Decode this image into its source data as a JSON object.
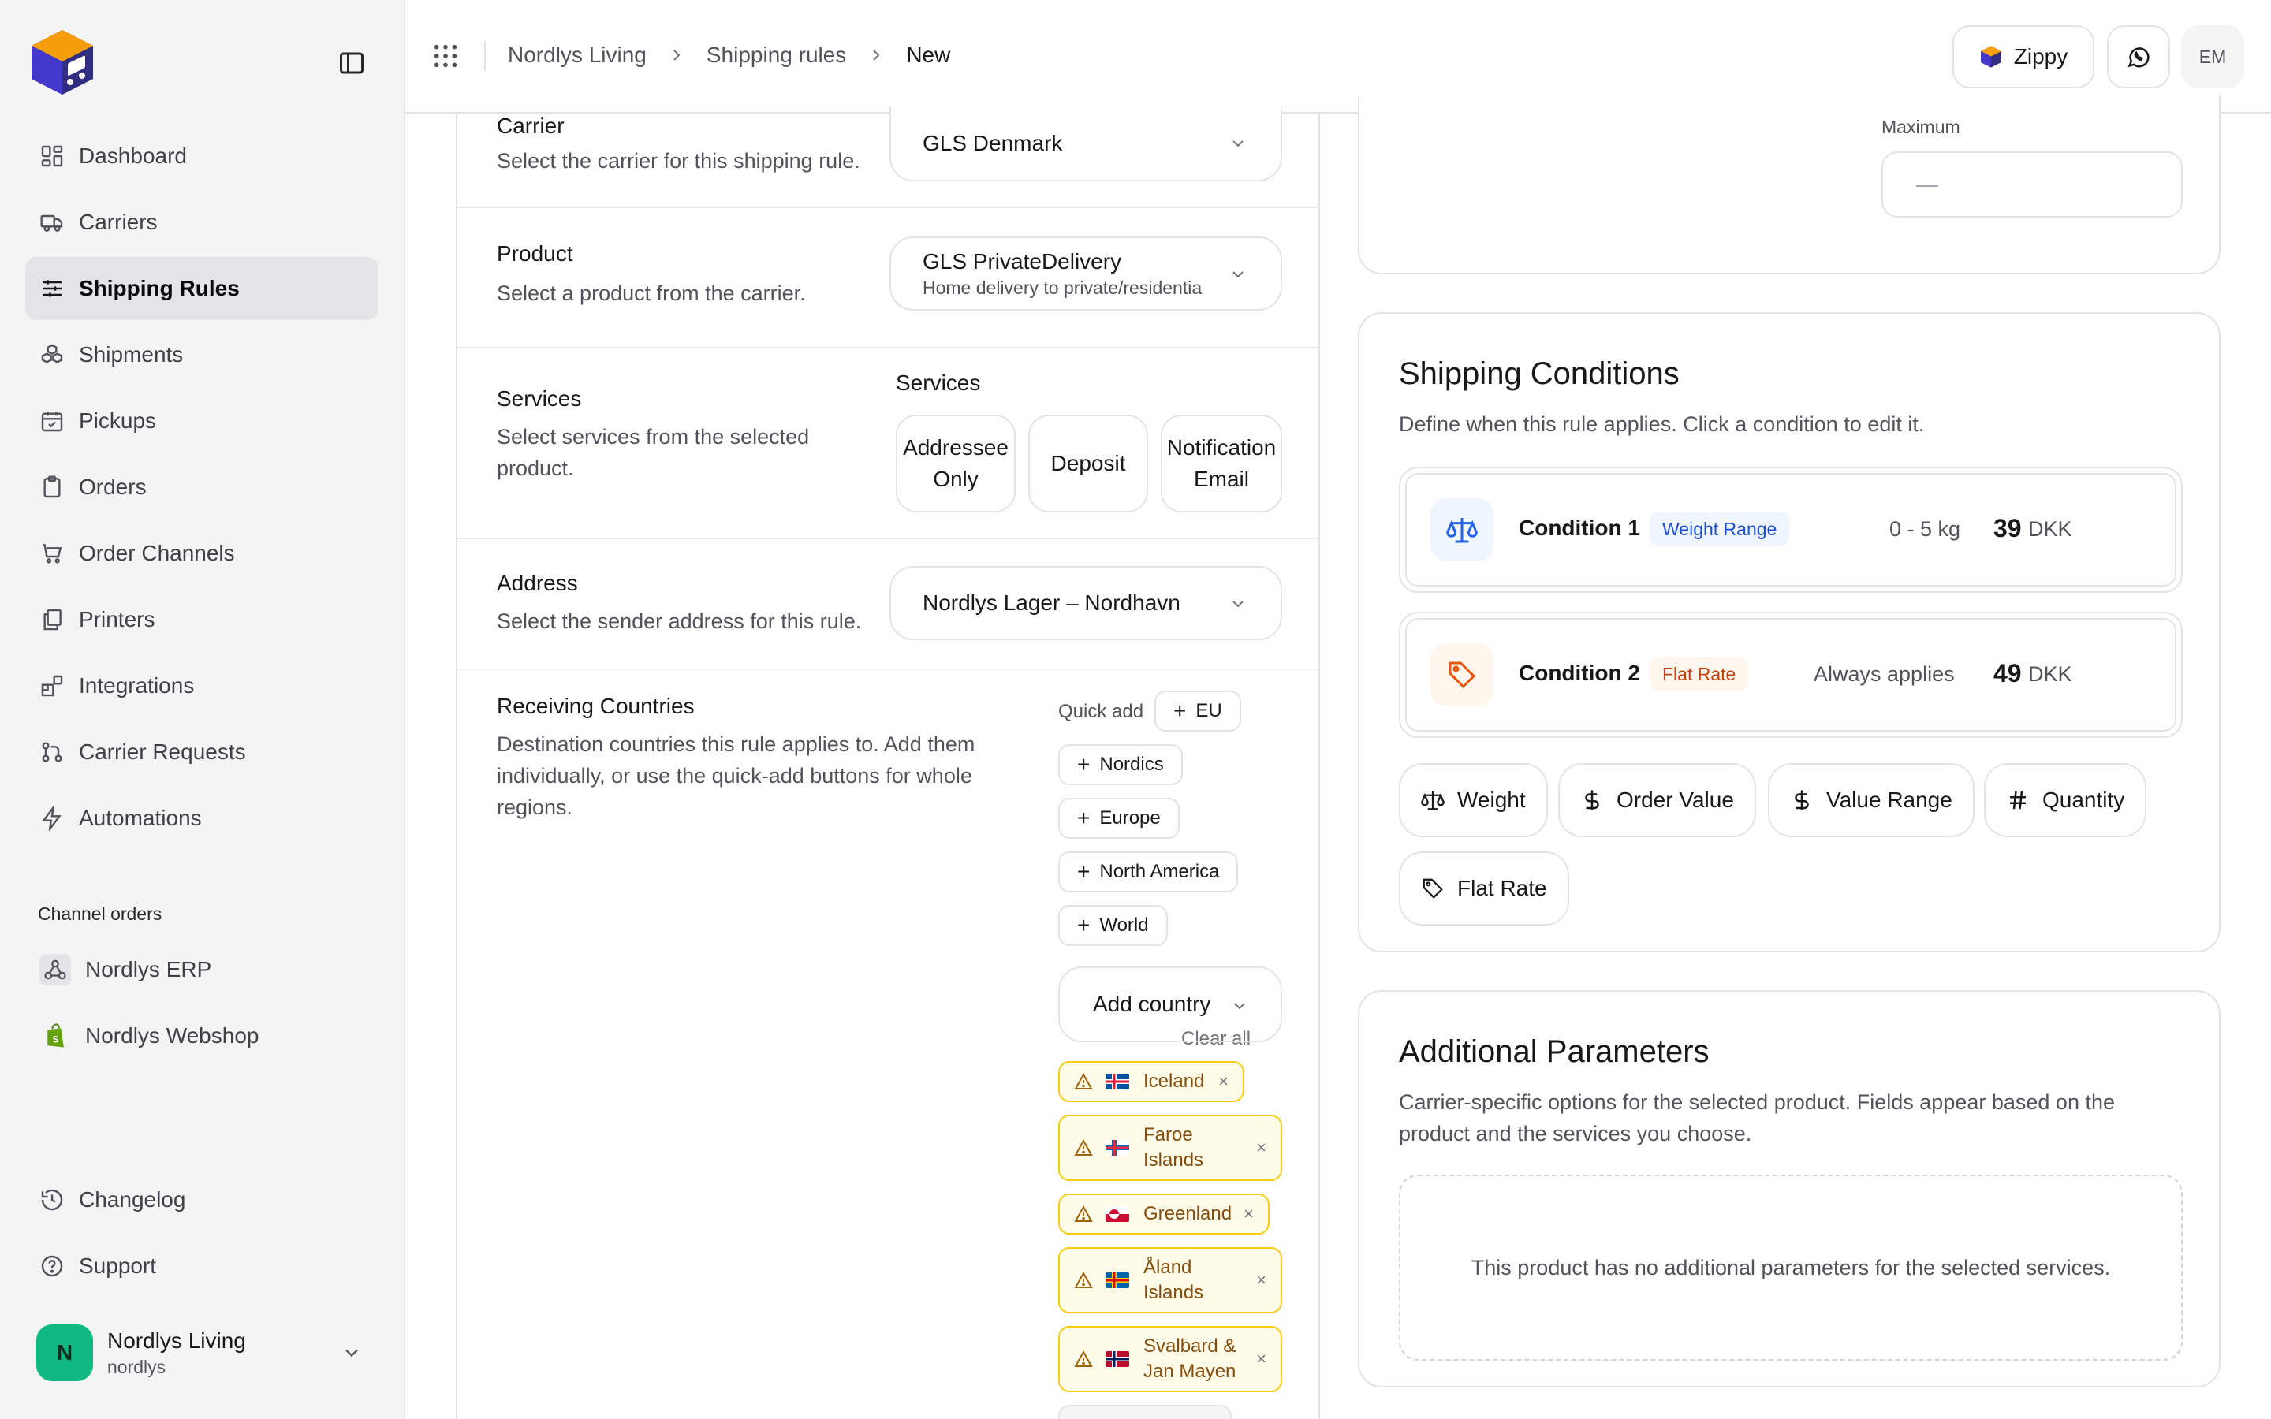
{
  "brand": {
    "logo_icon": "cube-truck-logo",
    "accent": "#f59e0b",
    "primary": "#312e81"
  },
  "nav": {
    "items": [
      {
        "label": "Dashboard",
        "icon": "dashboard-icon"
      },
      {
        "label": "Carriers",
        "icon": "truck-icon"
      },
      {
        "label": "Shipping Rules",
        "icon": "sliders-icon",
        "active": true
      },
      {
        "label": "Shipments",
        "icon": "boxes-icon"
      },
      {
        "label": "Pickups",
        "icon": "calendar-icon"
      },
      {
        "label": "Orders",
        "icon": "clipboard-icon"
      },
      {
        "label": "Order Channels",
        "icon": "cart-icon"
      },
      {
        "label": "Printers",
        "icon": "printer-icon"
      },
      {
        "label": "Integrations",
        "icon": "blocks-icon"
      },
      {
        "label": "Carrier Requests",
        "icon": "git-pull-icon"
      },
      {
        "label": "Automations",
        "icon": "bolt-icon"
      }
    ],
    "channels_label": "Channel orders",
    "channels": [
      {
        "label": "Nordlys ERP",
        "icon": "webhook-icon"
      },
      {
        "label": "Nordlys Webshop",
        "icon": "shopify-icon"
      }
    ],
    "bottom": [
      {
        "label": "Changelog",
        "icon": "history-icon"
      },
      {
        "label": "Support",
        "icon": "help-icon"
      }
    ],
    "account": {
      "initial": "N",
      "name": "Nordlys Living",
      "handle": "nordlys"
    }
  },
  "topbar": {
    "breadcrumbs": [
      "Nordlys Living",
      "Shipping rules",
      "New"
    ],
    "zippy_label": "Zippy",
    "user_initials": "EM"
  },
  "form": {
    "carrier": {
      "title": "Carrier",
      "desc": "Select the carrier for this shipping rule.",
      "value": "GLS Denmark"
    },
    "product": {
      "title": "Product",
      "desc": "Select a product from the carrier.",
      "value": "GLS PrivateDelivery",
      "sub": "Home delivery to private/residentia"
    },
    "services": {
      "title": "Services",
      "desc_line1": "Select services from the selected",
      "desc_line2": "product.",
      "label": "Services",
      "options": [
        {
          "line1": "Addressee",
          "line2": "Only"
        },
        {
          "line1": "Deposit",
          "line2": ""
        },
        {
          "line1": "Notification",
          "line2": "Email"
        }
      ]
    },
    "address": {
      "title": "Address",
      "desc": "Select the sender address for this rule.",
      "value": "Nordlys Lager – Nordhavn"
    },
    "countries": {
      "title": "Receiving Countries",
      "desc_line1": "Destination countries this rule applies to. Add them",
      "desc_line2": "individually, or use the quick-add buttons for whole",
      "desc_line3": "regions.",
      "quick_add_label": "Quick add",
      "quick": [
        "EU",
        "Nordics",
        "Europe",
        "North America",
        "World"
      ],
      "clear_all": "Clear all",
      "add_country": "Add country",
      "selected": [
        {
          "line1": "Iceland",
          "line2": ""
        },
        {
          "line1": "Faroe",
          "line2": "Islands"
        },
        {
          "line1": "Greenland",
          "line2": ""
        },
        {
          "line1": "Åland",
          "line2": "Islands"
        },
        {
          "line1": "Svalbard &",
          "line2": "Jan Mayen"
        }
      ]
    }
  },
  "weight_card": {
    "max_label": "Maximum",
    "max_value": "—"
  },
  "conditions": {
    "title": "Shipping Conditions",
    "desc": "Define when this rule applies. Click a condition to edit it.",
    "items": [
      {
        "name": "Condition 1",
        "badge": "Weight Range",
        "range": "0 - 5 kg",
        "price": "39",
        "currency": "DKK",
        "icon": "scale-icon"
      },
      {
        "name": "Condition 2",
        "badge": "Flat Rate",
        "range": "Always applies",
        "price": "49",
        "currency": "DKK",
        "icon": "tag-icon"
      }
    ],
    "add_buttons": [
      "Weight",
      "Order Value",
      "Value Range",
      "Quantity",
      "Flat Rate"
    ]
  },
  "params": {
    "title": "Additional Parameters",
    "desc_line1": "Carrier-specific options for the selected product. Fields appear based on the",
    "desc_line2": "product and the services you choose.",
    "empty": "This product has no additional parameters for the selected services."
  }
}
